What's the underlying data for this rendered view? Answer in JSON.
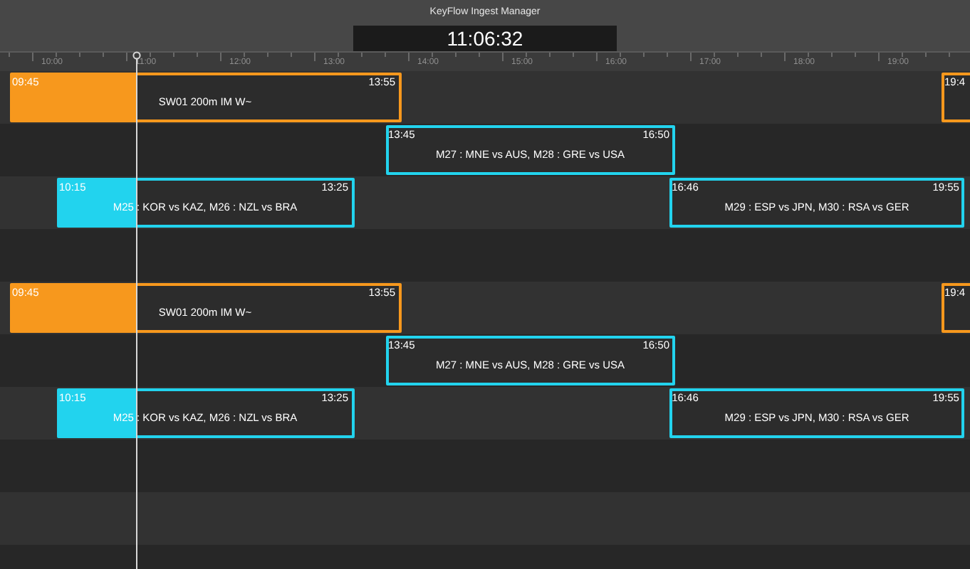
{
  "window": {
    "title": "KeyFlow Ingest Manager"
  },
  "clock": "11:06:32",
  "ruler": {
    "labels": [
      "10:00",
      "11:00",
      "12:00",
      "13:00",
      "14:00",
      "15:00",
      "16:00",
      "17:00",
      "18:00",
      "19:00"
    ]
  },
  "groups": [
    {
      "lanes": [
        {
          "events": [
            {
              "start": "09:45",
              "end": "13:55",
              "title": "SW01 200m IM W~",
              "color": "#f7981d"
            },
            {
              "start": "19:4",
              "color": "#f7981d"
            }
          ]
        },
        {
          "events": [
            {
              "start": "13:45",
              "end": "16:50",
              "title": "M27 : MNE vs AUS, M28 : GRE vs USA",
              "color": "#22d3ee"
            }
          ]
        },
        {
          "events": [
            {
              "start": "10:15",
              "end": "13:25",
              "title": "M25 : KOR vs KAZ, M26 : NZL vs BRA",
              "color": "#22d3ee"
            },
            {
              "start": "16:46",
              "end": "19:55",
              "title": "M29 : ESP vs JPN, M30 : RSA vs GER",
              "color": "#22d3ee"
            }
          ]
        }
      ]
    },
    {
      "lanes": [
        {
          "events": [
            {
              "start": "09:45",
              "end": "13:55",
              "title": "SW01 200m IM W~",
              "color": "#f7981d"
            },
            {
              "start": "19:4",
              "color": "#f7981d"
            }
          ]
        },
        {
          "events": [
            {
              "start": "13:45",
              "end": "16:50",
              "title": "M27 : MNE vs AUS, M28 : GRE vs USA",
              "color": "#22d3ee"
            }
          ]
        },
        {
          "events": [
            {
              "start": "10:15",
              "end": "13:25",
              "title": "M25 : KOR vs KAZ, M26 : NZL vs BRA",
              "color": "#22d3ee"
            },
            {
              "start": "16:46",
              "end": "19:55",
              "title": "M29 : ESP vs JPN, M30 : RSA vs GER",
              "color": "#22d3ee"
            }
          ]
        }
      ]
    }
  ]
}
